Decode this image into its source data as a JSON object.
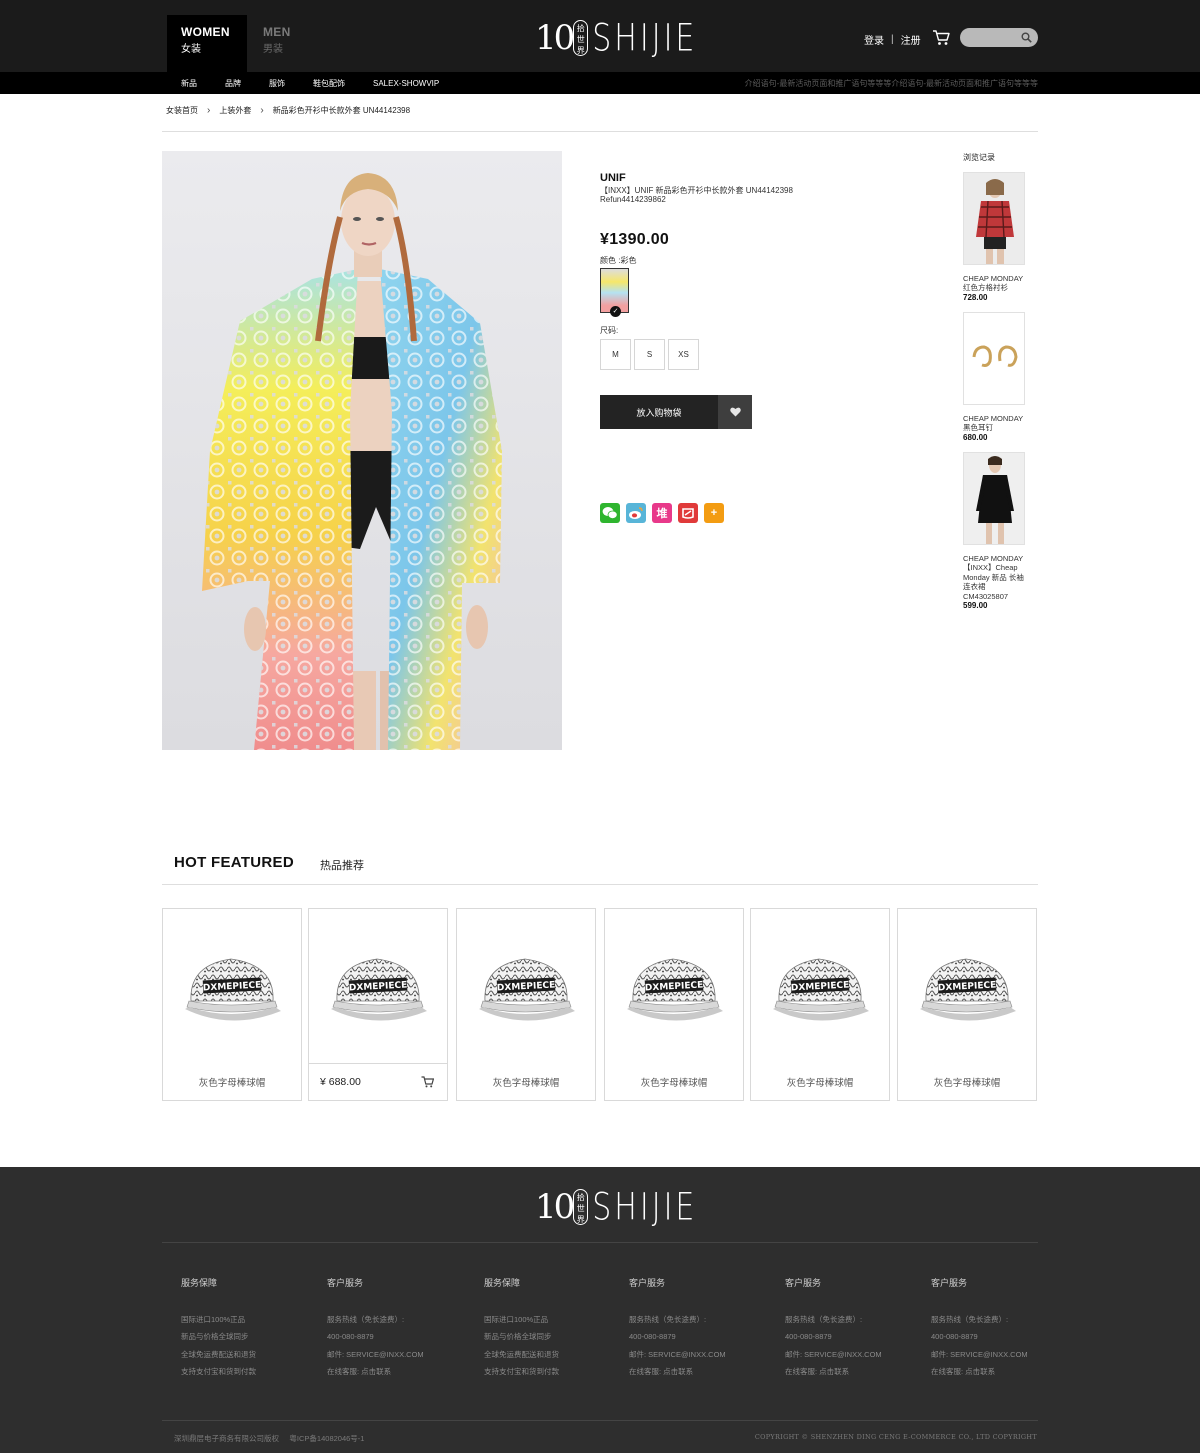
{
  "header": {
    "women": {
      "en": "WOMEN",
      "cn": "女装"
    },
    "men": {
      "en": "MEN",
      "cn": "男装"
    },
    "logo": {
      "digits": "10",
      "seal": "拾世界",
      "word": "SHIJIE"
    },
    "login": "登录",
    "register": "注册",
    "search_placeholder": ""
  },
  "nav": {
    "items": [
      "新品",
      "品牌",
      "服饰",
      "鞋包配饰",
      "SALEX-SHOWVIP"
    ],
    "promo": "介绍语句-最新活动页面和推广语句等等等介绍语句-最新活动页面和推广语句等等等"
  },
  "breadcrumb": [
    "女装首页",
    "上装外套",
    "新品彩色开衫中长款外套 UN44142398"
  ],
  "product": {
    "brand": "UNIF",
    "name": "【INXX】UNIF 新品彩色开衫中长款外套 UN44142398",
    "sku": "Refun4414239862",
    "price": "¥1390.00",
    "color_label": "颜色 :彩色",
    "size_label": "尺码:",
    "sizes": [
      "M",
      "S",
      "XS"
    ],
    "add_to_cart": "放入购物袋",
    "share": [
      {
        "icon": "wechat-icon",
        "color": "#2fb52f",
        "glyph": ""
      },
      {
        "icon": "weibo-icon",
        "color": "#58b5d8",
        "glyph": ""
      },
      {
        "icon": "duitang-icon",
        "color": "#e8398a",
        "glyph": "堆"
      },
      {
        "icon": "qzone-icon",
        "color": "#e03a3a",
        "glyph": ""
      },
      {
        "icon": "more-share-icon",
        "color": "#f39c12",
        "glyph": "+"
      }
    ]
  },
  "history": {
    "title": "浏览记录",
    "items": [
      {
        "brand": "CHEAP MONDAY",
        "name": "红色方格衬衫",
        "price": "728.00"
      },
      {
        "brand": "CHEAP MONDAY",
        "name": "黑色耳钉",
        "price": "680.00"
      },
      {
        "brand": "CHEAP MONDAY",
        "name": "【INXX】Cheap Monday 新品 长袖连衣裙 CM43025807",
        "price": "599.00"
      }
    ]
  },
  "hot": {
    "title": "HOT FEATURED",
    "subtitle": "热品推荐",
    "cap_text": "DXMEPIECE",
    "cards": [
      {
        "name": "灰色字母棒球帽"
      },
      {
        "price": "¥ 688.00"
      },
      {
        "name": "灰色字母棒球帽"
      },
      {
        "name": "灰色字母棒球帽"
      },
      {
        "name": "灰色字母棒球帽"
      },
      {
        "name": "灰色字母棒球帽"
      }
    ]
  },
  "footer": {
    "columns": [
      {
        "head": "服务保障",
        "lines": [
          "国际进口100%正品",
          "新品与价格全球同步",
          "全球免运费配送和退货",
          "支持支付宝和货到付款"
        ]
      },
      {
        "head": "客户服务",
        "lines": [
          "服务热线（免长途费）:",
          "400-080-8879",
          "邮件: SERVICE@INXX.COM",
          "在线客服: 点击联系"
        ]
      },
      {
        "head": "服务保障",
        "lines": [
          "国际进口100%正品",
          "新品与价格全球同步",
          "全球免运费配送和退货",
          "支持支付宝和货到付款"
        ]
      },
      {
        "head": "客户服务",
        "lines": [
          "服务热线（免长途费）:",
          "400-080-8879",
          "邮件: SERVICE@INXX.COM",
          "在线客服: 点击联系"
        ]
      },
      {
        "head": "客户服务",
        "lines": [
          "服务热线（免长途费）:",
          "400-080-8879",
          "邮件: SERVICE@INXX.COM",
          "在线客服: 点击联系"
        ]
      },
      {
        "head": "客户服务",
        "lines": [
          "服务热线（免长途费）:",
          "400-080-8879",
          "邮件: SERVICE@INXX.COM",
          "在线客服: 点击联系"
        ]
      }
    ],
    "company": "深圳鼎层电子商务有限公司版权",
    "icp": "粤ICP备14082046号-1",
    "copyright": "COPYRIGHT © SHENZHEN DING CENG E-COMMERCE CO., LTD COPYRIGHT"
  }
}
